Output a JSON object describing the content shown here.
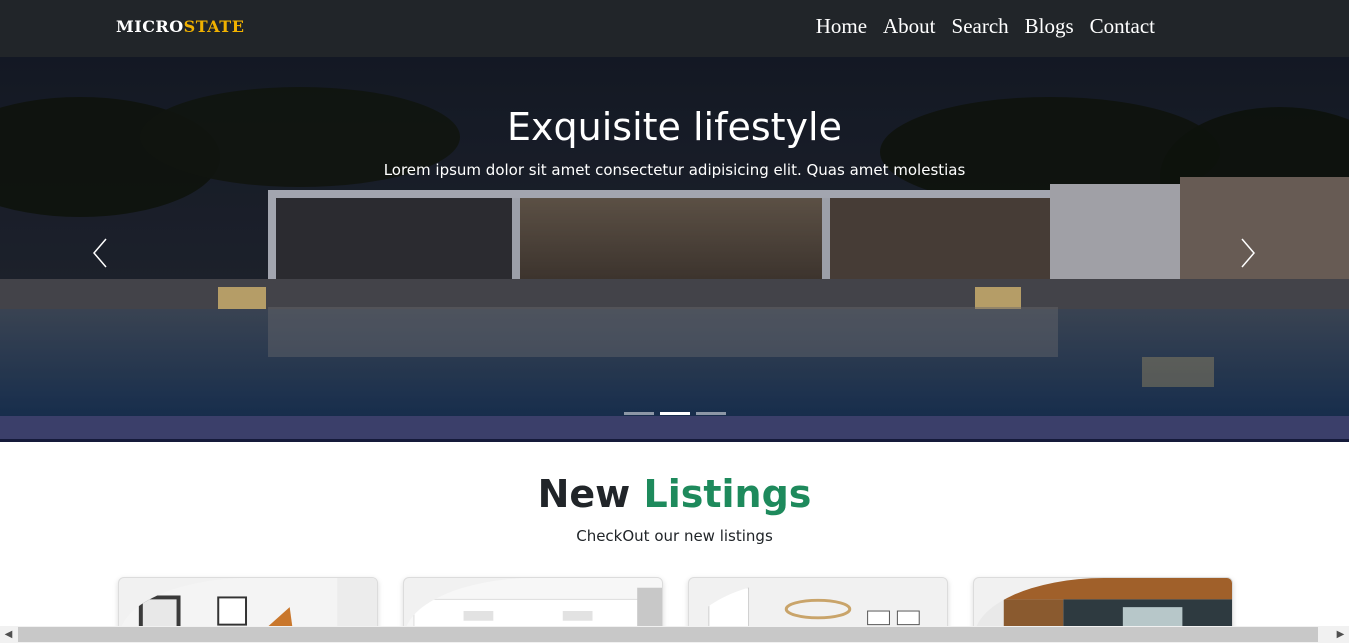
{
  "brand": {
    "part1": "MICRO",
    "part2": "STATE"
  },
  "nav": {
    "items": [
      "Home",
      "About",
      "Search",
      "Blogs",
      "Contact"
    ]
  },
  "hero": {
    "title": "Exquisite lifestyle",
    "subtitle": "Lorem ipsum dolor sit amet consectetur adipisicing elit. Quas amet molestias",
    "active_slide": 2,
    "slide_count": 3
  },
  "listings": {
    "title_part1": "New",
    "title_part2": "Listings",
    "subtitle": "CheckOut our new listings",
    "cards": [
      "listing-1",
      "listing-2",
      "listing-3",
      "listing-4"
    ]
  },
  "colors": {
    "navbar": "#212529",
    "brand_accent": "#f0b100",
    "listings_accent": "#1e8a5c"
  },
  "icons": {
    "prev": "chevron-left-icon",
    "next": "chevron-right-icon"
  }
}
